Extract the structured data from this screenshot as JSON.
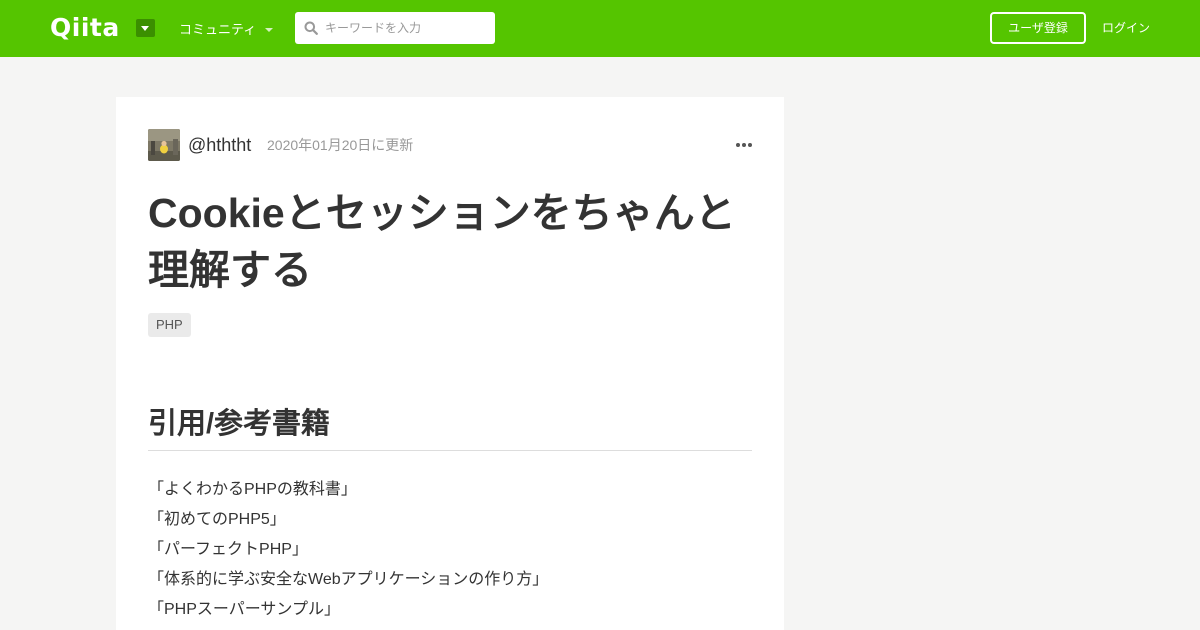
{
  "header": {
    "logo": "Qiita",
    "community_label": "コミュニティ",
    "search_placeholder": "キーワードを入力",
    "signup_label": "ユーザ登録",
    "login_label": "ログイン"
  },
  "article": {
    "author": "@hththt",
    "updated": "2020年01月20日に更新",
    "title_line1": "Cookieとセッションをちゃんと",
    "title_line2": "理解する",
    "tags": [
      "PHP"
    ],
    "section_heading": "引用/参考書籍",
    "books": [
      "「よくわかるPHPの教科書」",
      "「初めてのPHP5」",
      "「パーフェクトPHP」",
      "「体系的に学ぶ安全なWebアプリケーションの作り方」",
      "「PHPスーパーサンプル」"
    ]
  },
  "colors": {
    "brand": "#55c500",
    "brand_dark": "#3b8f00",
    "background": "#f5f5f4"
  }
}
